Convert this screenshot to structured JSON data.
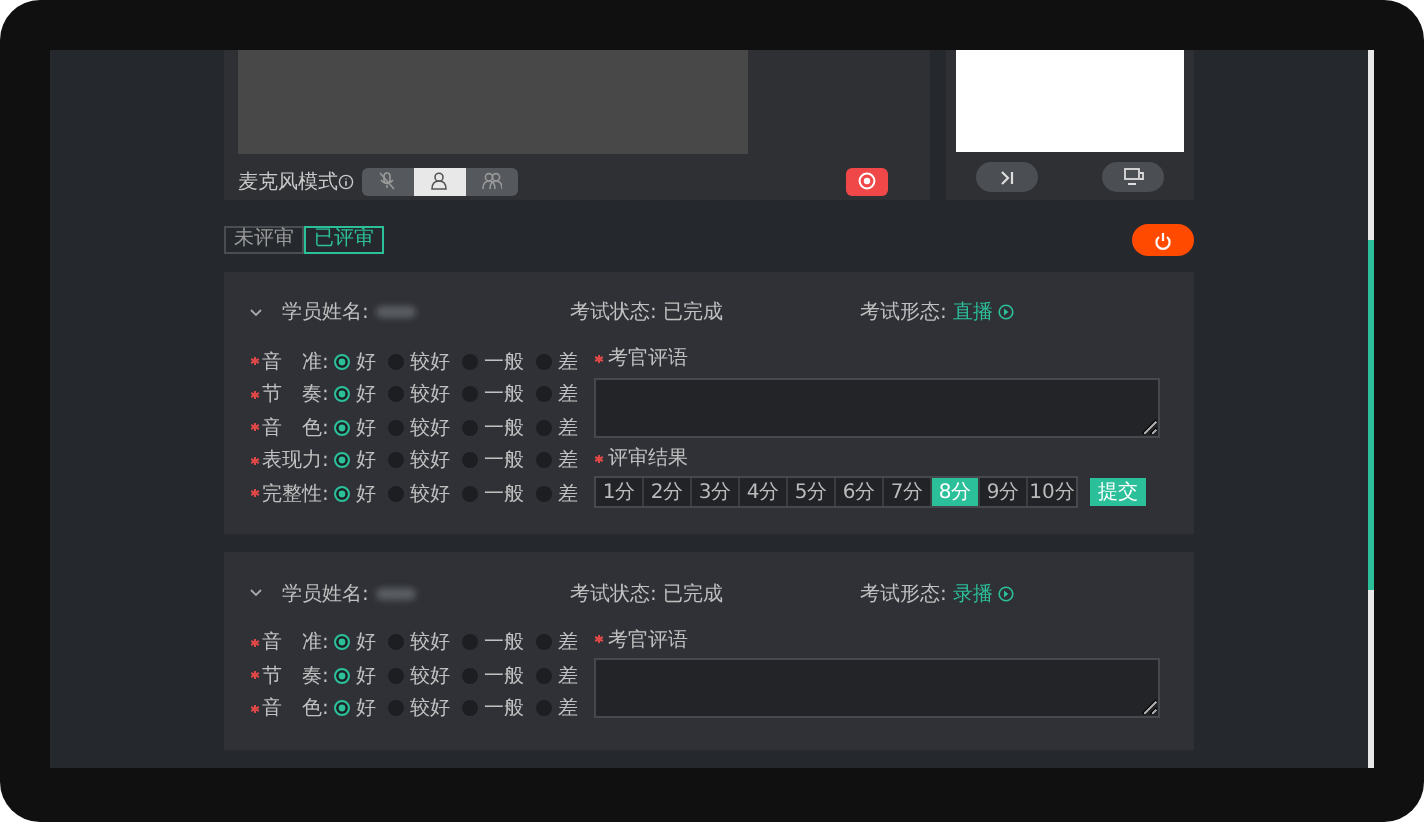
{
  "monitor": {
    "mic_mode_label": "麦克风模式",
    "mic_modes": [
      {
        "kind": "mic-off",
        "selected": false
      },
      {
        "kind": "single",
        "selected": true
      },
      {
        "kind": "group",
        "selected": false
      }
    ]
  },
  "tabs": [
    {
      "label": "未评审",
      "selected": false
    },
    {
      "label": "已评审",
      "selected": true
    }
  ],
  "students": [
    {
      "name_label": "学员姓名:",
      "status_label": "考试状态:",
      "status": "已完成",
      "form_label": "考试形态:",
      "form": "直播",
      "criteria": [
        {
          "label": "音　准:",
          "required": true,
          "options": [
            {
              "label": "好",
              "selected": true
            },
            {
              "label": "较好",
              "selected": false
            },
            {
              "label": "一般",
              "selected": false
            },
            {
              "label": "差",
              "selected": false
            }
          ]
        },
        {
          "label": "节　奏:",
          "required": true,
          "options": [
            {
              "label": "好",
              "selected": true
            },
            {
              "label": "较好",
              "selected": false
            },
            {
              "label": "一般",
              "selected": false
            },
            {
              "label": "差",
              "selected": false
            }
          ]
        },
        {
          "label": "音　色:",
          "required": true,
          "options": [
            {
              "label": "好",
              "selected": true
            },
            {
              "label": "较好",
              "selected": false
            },
            {
              "label": "一般",
              "selected": false
            },
            {
              "label": "差",
              "selected": false
            }
          ]
        },
        {
          "label": "表现力:",
          "required": true,
          "options": [
            {
              "label": "好",
              "selected": true
            },
            {
              "label": "较好",
              "selected": false
            },
            {
              "label": "一般",
              "selected": false
            },
            {
              "label": "差",
              "selected": false
            }
          ]
        },
        {
          "label": "完整性:",
          "required": true,
          "options": [
            {
              "label": "好",
              "selected": true
            },
            {
              "label": "较好",
              "selected": false
            },
            {
              "label": "一般",
              "selected": false
            },
            {
              "label": "差",
              "selected": false
            }
          ]
        }
      ],
      "comment_label": "考官评语",
      "result_label": "评审结果",
      "scores": [
        {
          "label": "1分",
          "selected": false
        },
        {
          "label": "2分",
          "selected": false
        },
        {
          "label": "3分",
          "selected": false
        },
        {
          "label": "4分",
          "selected": false
        },
        {
          "label": "5分",
          "selected": false
        },
        {
          "label": "6分",
          "selected": false
        },
        {
          "label": "7分",
          "selected": false
        },
        {
          "label": "8分",
          "selected": true
        },
        {
          "label": "9分",
          "selected": false
        },
        {
          "label": "10分",
          "selected": false
        }
      ],
      "submit": "提交"
    },
    {
      "name_label": "学员姓名:",
      "status_label": "考试状态:",
      "status": "已完成",
      "form_label": "考试形态:",
      "form": "录播",
      "criteria": [
        {
          "label": "音　准:",
          "required": true,
          "options": [
            {
              "label": "好",
              "selected": true
            },
            {
              "label": "较好",
              "selected": false
            },
            {
              "label": "一般",
              "selected": false
            },
            {
              "label": "差",
              "selected": false
            }
          ]
        },
        {
          "label": "节　奏:",
          "required": true,
          "options": [
            {
              "label": "好",
              "selected": true
            },
            {
              "label": "较好",
              "selected": false
            },
            {
              "label": "一般",
              "selected": false
            },
            {
              "label": "差",
              "selected": false
            }
          ]
        },
        {
          "label": "音　色:",
          "required": true,
          "options": [
            {
              "label": "好",
              "selected": true
            },
            {
              "label": "较好",
              "selected": false
            },
            {
              "label": "一般",
              "selected": false
            },
            {
              "label": "差",
              "selected": false
            }
          ]
        }
      ],
      "comment_label": "考官评语"
    }
  ]
}
